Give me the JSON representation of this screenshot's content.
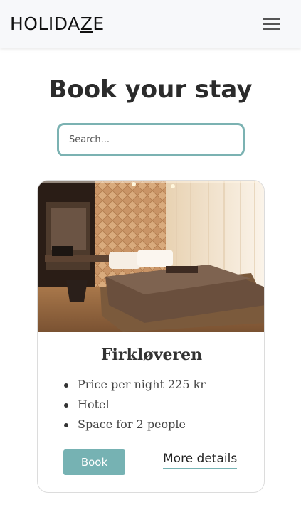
{
  "navbar": {
    "logo_text": "HOLIDA",
    "logo_z": "Z",
    "logo_end": "E",
    "menu_icon": "hamburger-menu-icon"
  },
  "main": {
    "heading": "Book your stay",
    "search": {
      "placeholder": "Search...",
      "value": ""
    }
  },
  "cards": [
    {
      "title": "Firkløveren",
      "features": [
        "Price per night 225 kr",
        "Hotel",
        "Space for 2 people"
      ],
      "book_label": "Book",
      "details_label": "More details"
    }
  ],
  "colors": {
    "accent": "#76b2b3",
    "navbar_bg": "#f7f8fa",
    "heading": "#2b2b2b"
  }
}
